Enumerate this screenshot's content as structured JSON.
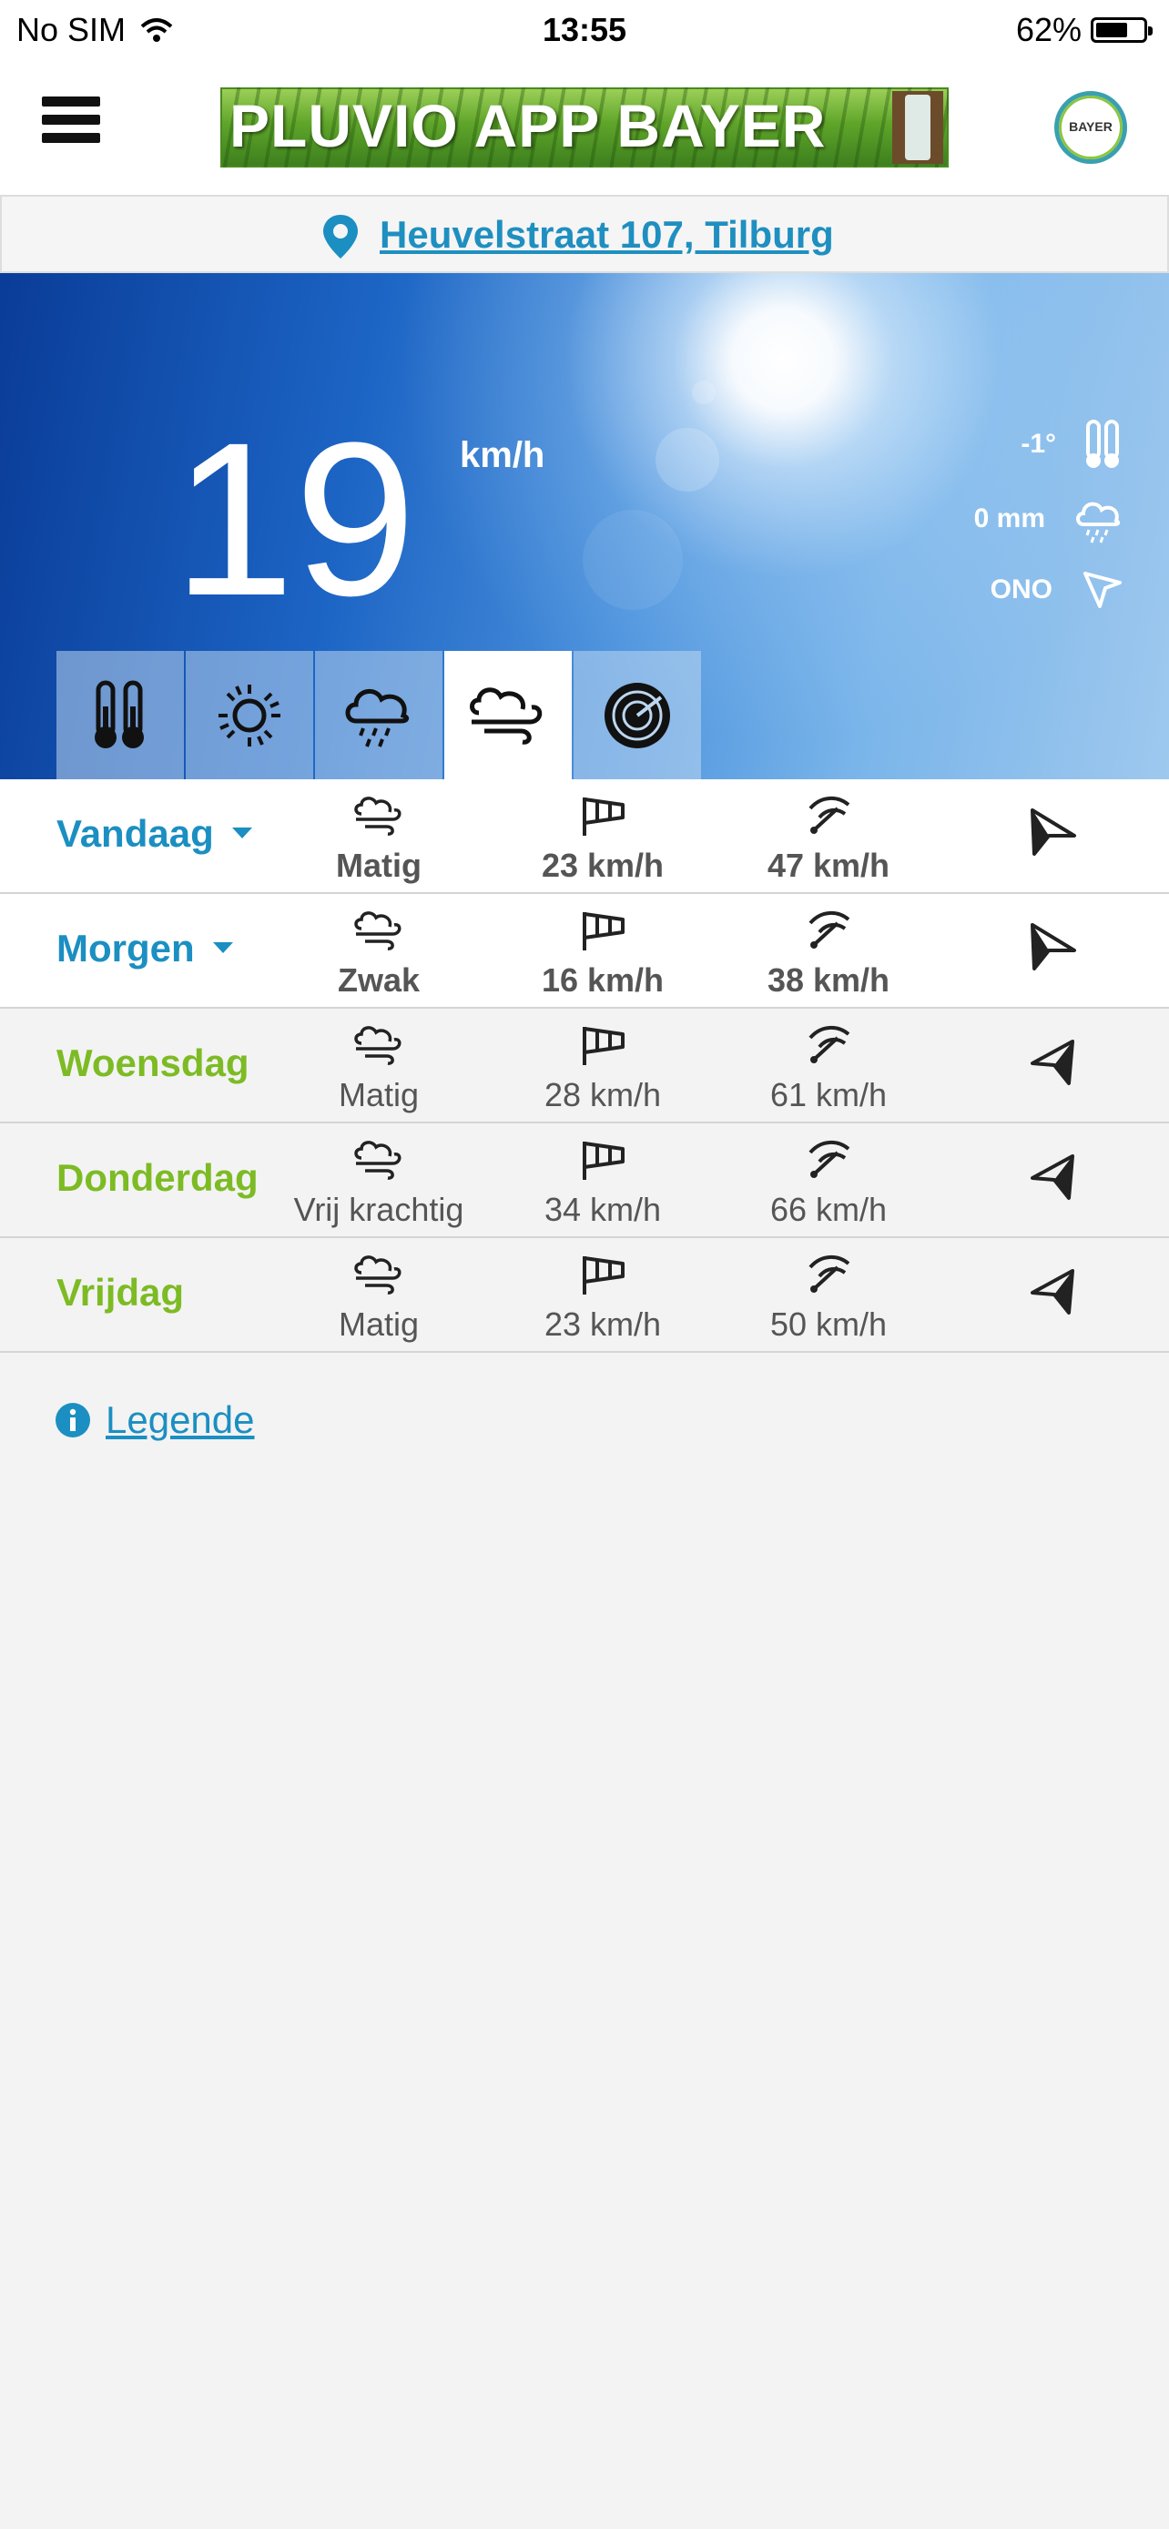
{
  "status_bar": {
    "carrier": "No SIM",
    "time": "13:55",
    "battery": "62%"
  },
  "header": {
    "banner_text": "PLUVIO APP BAYER",
    "logo_text": "BAYER"
  },
  "location": {
    "address": "Heuvelstraat 107, Tilburg"
  },
  "hero": {
    "value": "19",
    "unit": "km/h",
    "side": [
      {
        "value": "-1°",
        "icon": "thermometer-icon"
      },
      {
        "value": "0 mm",
        "icon": "rain-cloud-icon"
      },
      {
        "value": "ONO",
        "icon": "direction-arrow-icon"
      }
    ],
    "tabs": [
      {
        "icon": "thermometer-icon",
        "active": false
      },
      {
        "icon": "sun-icon",
        "active": false
      },
      {
        "icon": "rain-cloud-icon",
        "active": false
      },
      {
        "icon": "wind-icon",
        "active": true
      },
      {
        "icon": "radar-icon",
        "active": false
      }
    ]
  },
  "forecast": [
    {
      "day": "Vandaag",
      "dropdown": true,
      "color": "#1b8fc1",
      "bold": true,
      "wind": "Matig",
      "avg": "23 km/h",
      "gust": "47 km/h",
      "direction": "right"
    },
    {
      "day": "Morgen",
      "dropdown": true,
      "color": "#1b8fc1",
      "bold": true,
      "wind": "Zwak",
      "avg": "16 km/h",
      "gust": "38 km/h",
      "direction": "right"
    },
    {
      "day": "Woensdag",
      "dropdown": false,
      "color": "#7dbb24",
      "bold": false,
      "wind": "Matig",
      "avg": "28 km/h",
      "gust": "61 km/h",
      "direction": "left"
    },
    {
      "day": "Donderdag",
      "dropdown": false,
      "color": "#7dbb24",
      "bold": false,
      "wind": "Vrij krachtig",
      "avg": "34 km/h",
      "gust": "66 km/h",
      "direction": "left"
    },
    {
      "day": "Vrijdag",
      "dropdown": false,
      "color": "#7dbb24",
      "bold": false,
      "wind": "Matig",
      "avg": "23 km/h",
      "gust": "50 km/h",
      "direction": "left"
    }
  ],
  "legend": {
    "label": "Legende",
    "icon": "info-icon"
  }
}
